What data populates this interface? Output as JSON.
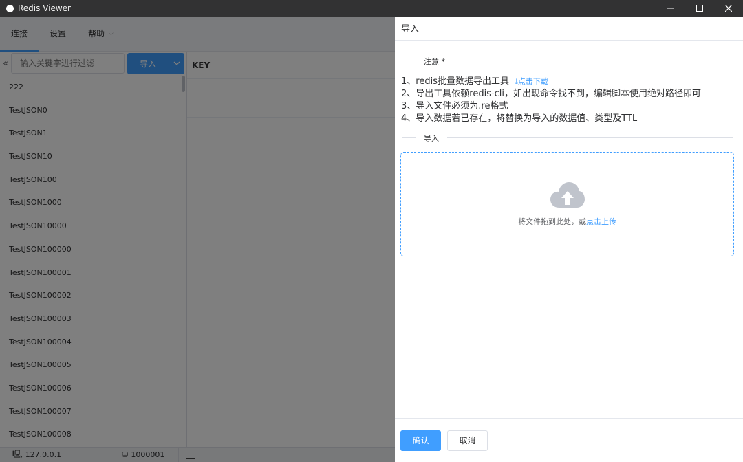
{
  "window": {
    "title": "Redis Viewer",
    "controls": {
      "minimize": "–",
      "maximize": "☐",
      "close": "✕"
    }
  },
  "menu": {
    "items": [
      {
        "label": "连接"
      },
      {
        "label": "设置"
      },
      {
        "label": "帮助"
      }
    ]
  },
  "sidebar": {
    "filter_placeholder": "输入关键字进行过滤",
    "import_label": "导入",
    "keys": [
      "222",
      "TestJSON0",
      "TestJSON1",
      "TestJSON10",
      "TestJSON100",
      "TestJSON1000",
      "TestJSON10000",
      "TestJSON100000",
      "TestJSON100001",
      "TestJSON100002",
      "TestJSON100003",
      "TestJSON100004",
      "TestJSON100005",
      "TestJSON100006",
      "TestJSON100007",
      "TestJSON100008"
    ]
  },
  "main": {
    "key_header": "KEY"
  },
  "status": {
    "host": "127.0.0.1",
    "db_count": "1000001"
  },
  "drawer": {
    "title": "导入",
    "notice_label": "注意 *",
    "notes": {
      "n1": "1、redis批量数据导出工具",
      "n1_link": "点击下载",
      "n2": "2、导出工具依赖redis-cli，如出现命令找不到，编辑脚本使用绝对路径即可",
      "n3": "3、导入文件必须为.re格式",
      "n4": "4、导入数据若已存在，将替换为导入的数据值、类型及TTL"
    },
    "import_label": "导入",
    "upload_text": "将文件拖到此处，或",
    "upload_link": "点击上传",
    "confirm": "确认",
    "cancel": "取消"
  },
  "colors": {
    "accent": "#409eff",
    "titlebar": "#323233"
  }
}
